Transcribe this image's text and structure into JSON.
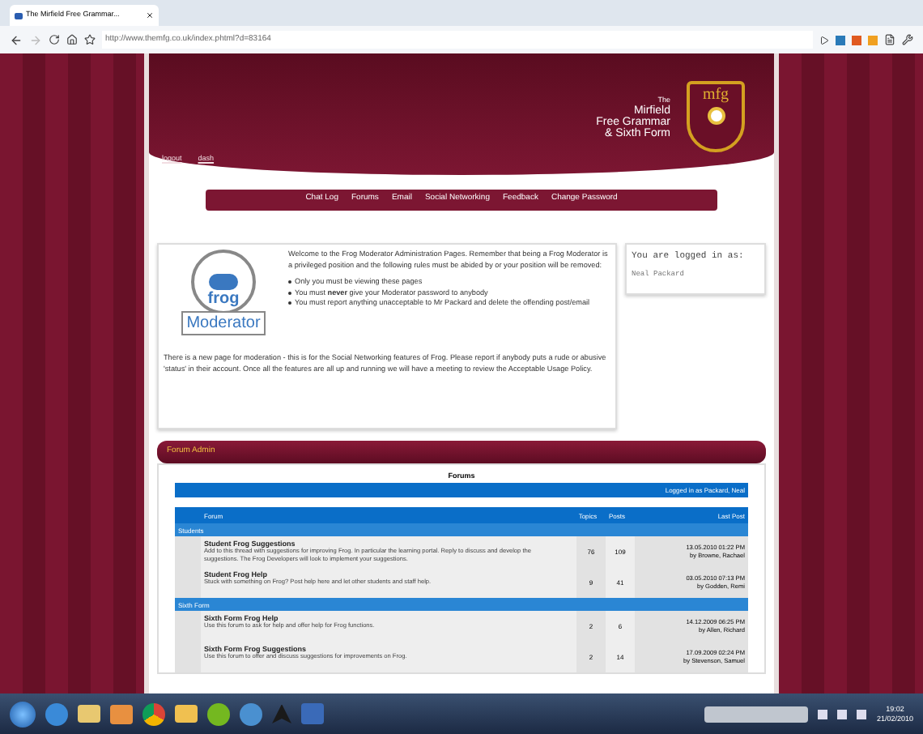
{
  "browser": {
    "tab_title": "The Mirfield Free Grammar...",
    "url": "http://www.themfg.co.uk/index.phtml?d=83164"
  },
  "header": {
    "school_name": [
      "The",
      "Mirfield",
      "Free Grammar",
      "& Sixth Form"
    ],
    "crest_text": "mfg",
    "links": [
      "logout",
      "dash"
    ]
  },
  "nav": [
    "Chat Log",
    "Forums",
    "Email",
    "Social Networking",
    "Feedback",
    "Change Password"
  ],
  "welcome": {
    "logo_top": "frog",
    "logo_bottom": "Moderator",
    "intro": "Welcome to the Frog Moderator Administration Pages. Remember that being a Frog Moderator is a privileged position and the following rules must be abided by or your position will be removed:",
    "rules": [
      "Only you must be viewing these pages",
      "You must **never** give your Moderator password to anybody",
      "You must report anything unacceptable to Mr Packard and delete the offending post/email"
    ],
    "notice": "There is a new page for moderation - this is for the Social Networking features of Frog. Please report if anybody puts a rude or abusive 'status' in their account. Once all the features are all up and running we will have a meeting to review the Acceptable Usage Policy."
  },
  "login_panel": {
    "label": "You are logged in as:",
    "user": "Neal Packard"
  },
  "forum_admin": {
    "title": "Forum Admin",
    "heading": "Forums",
    "logged_in": "Logged in as Packard, Neal",
    "columns": [
      "Forum",
      "Topics",
      "Posts",
      "Last Post"
    ],
    "sections": [
      {
        "name": "Students",
        "forums": [
          {
            "title": "Student Frog Suggestions",
            "description": "Add to this thread with suggestions for improving Frog. In particular the learning portal. Reply to discuss and develop the suggestions. The Frog Developers will look to implement your suggestions.",
            "topics": "76",
            "posts": "109",
            "last_post_date": "13.05.2010 01:22 PM",
            "last_post_by": "by Browne, Rachael"
          },
          {
            "title": "Student Frog Help",
            "description": "Stuck with something on Frog? Post help here and let other students and staff help.",
            "topics": "9",
            "posts": "41",
            "last_post_date": "03.05.2010 07:13 PM",
            "last_post_by": "by Godden, Remi"
          }
        ]
      },
      {
        "name": "Sixth Form",
        "forums": [
          {
            "title": "Sixth Form Frog Help",
            "description": "Use this forum to ask for help and offer help for Frog functions.",
            "topics": "2",
            "posts": "6",
            "last_post_date": "14.12.2009 06:25 PM",
            "last_post_by": "by Allen, Richard"
          },
          {
            "title": "Sixth Form Frog Suggestions",
            "description": "Use this forum to offer and discuss suggestions for improvements on Frog.",
            "topics": "2",
            "posts": "14",
            "last_post_date": "17.09.2009 02:24 PM",
            "last_post_by": "by Stevenson, Samuel"
          }
        ]
      }
    ]
  },
  "taskbar": {
    "time": "19:02",
    "date": "21/02/2010"
  }
}
